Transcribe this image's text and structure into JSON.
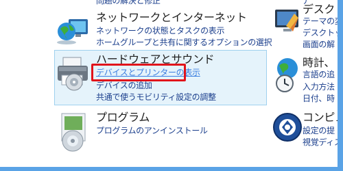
{
  "top_cut_text": "問題の解決と修正",
  "categories": {
    "network": {
      "title": "ネットワークとインターネット",
      "links": [
        "ネットワークの状態とタスクの表示",
        "ホームグループと共有に関するオプションの選択"
      ]
    },
    "hardware": {
      "title": "ハードウェアとサウンド",
      "links": [
        "デバイスとプリンターの表示",
        "デバイスの追加",
        "共通で使うモビリティ設定の調整"
      ]
    },
    "programs": {
      "title": "プログラム",
      "links": [
        "プログラムのアンインストール"
      ]
    },
    "desktop": {
      "title": "デスクト",
      "links": [
        "テーマの変",
        "デスクトッ",
        "画面の解"
      ]
    },
    "clock": {
      "title": "時計、",
      "links": [
        "言語の追",
        "入力方法",
        "日付、時"
      ]
    },
    "ease": {
      "title": "コンピュ",
      "links": [
        "設定の提",
        "視覚ディス"
      ]
    }
  },
  "colors": {
    "highlight_bg": "#e5f3fb",
    "highlight_border": "#9fd0ee",
    "red": "#e1141b",
    "link": "#1a3e8c",
    "frame": "#5aa3e6"
  }
}
